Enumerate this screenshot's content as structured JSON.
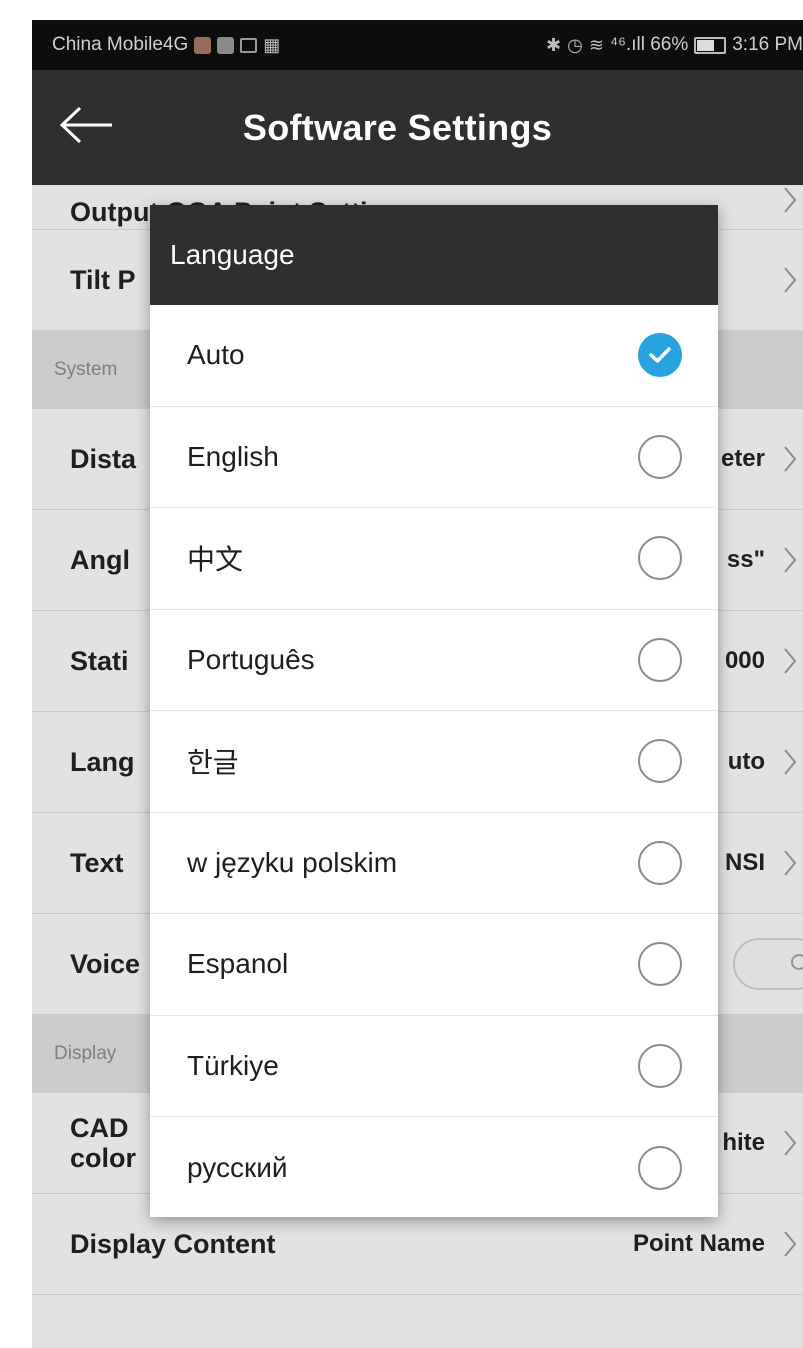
{
  "status_bar": {
    "carrier": "China Mobile4G",
    "right_text": "⁴⁶.ıll 66%",
    "time": "3:16 PM"
  },
  "header": {
    "title": "Software Settings",
    "back_icon": "back-arrow-icon"
  },
  "settings": {
    "partial_row_label": "Output GGA Point Settings",
    "tilt_label": "Tilt P",
    "system_section": "System",
    "rows": [
      {
        "label": "Dista",
        "value": "eter"
      },
      {
        "label": "Angl",
        "value": "ss\""
      },
      {
        "label": "Stati",
        "value": "000"
      },
      {
        "label": "Lang",
        "value": "uto"
      },
      {
        "label": "Text",
        "value": "NSI"
      }
    ],
    "voice_label": "Voice",
    "display_section": "Display",
    "cad_label_1": "CAD",
    "cad_label_2": "color",
    "cad_value": "hite",
    "display_content_label": "Display Content",
    "display_content_value": "Point Name"
  },
  "dialog": {
    "title": "Language",
    "selected": "Auto",
    "options": [
      {
        "label": "Auto",
        "checked": true
      },
      {
        "label": "English",
        "checked": false
      },
      {
        "label": "中文",
        "checked": false
      },
      {
        "label": "Português",
        "checked": false
      },
      {
        "label": "한글",
        "checked": false
      },
      {
        "label": "w języku polskim",
        "checked": false
      },
      {
        "label": "Espanol",
        "checked": false
      },
      {
        "label": "Türkiye",
        "checked": false
      },
      {
        "label": "русский",
        "checked": false
      }
    ]
  },
  "colors": {
    "header_bg": "#2f2f2f",
    "status_bg": "#0d0d0d",
    "accent": "#29a3e0"
  }
}
